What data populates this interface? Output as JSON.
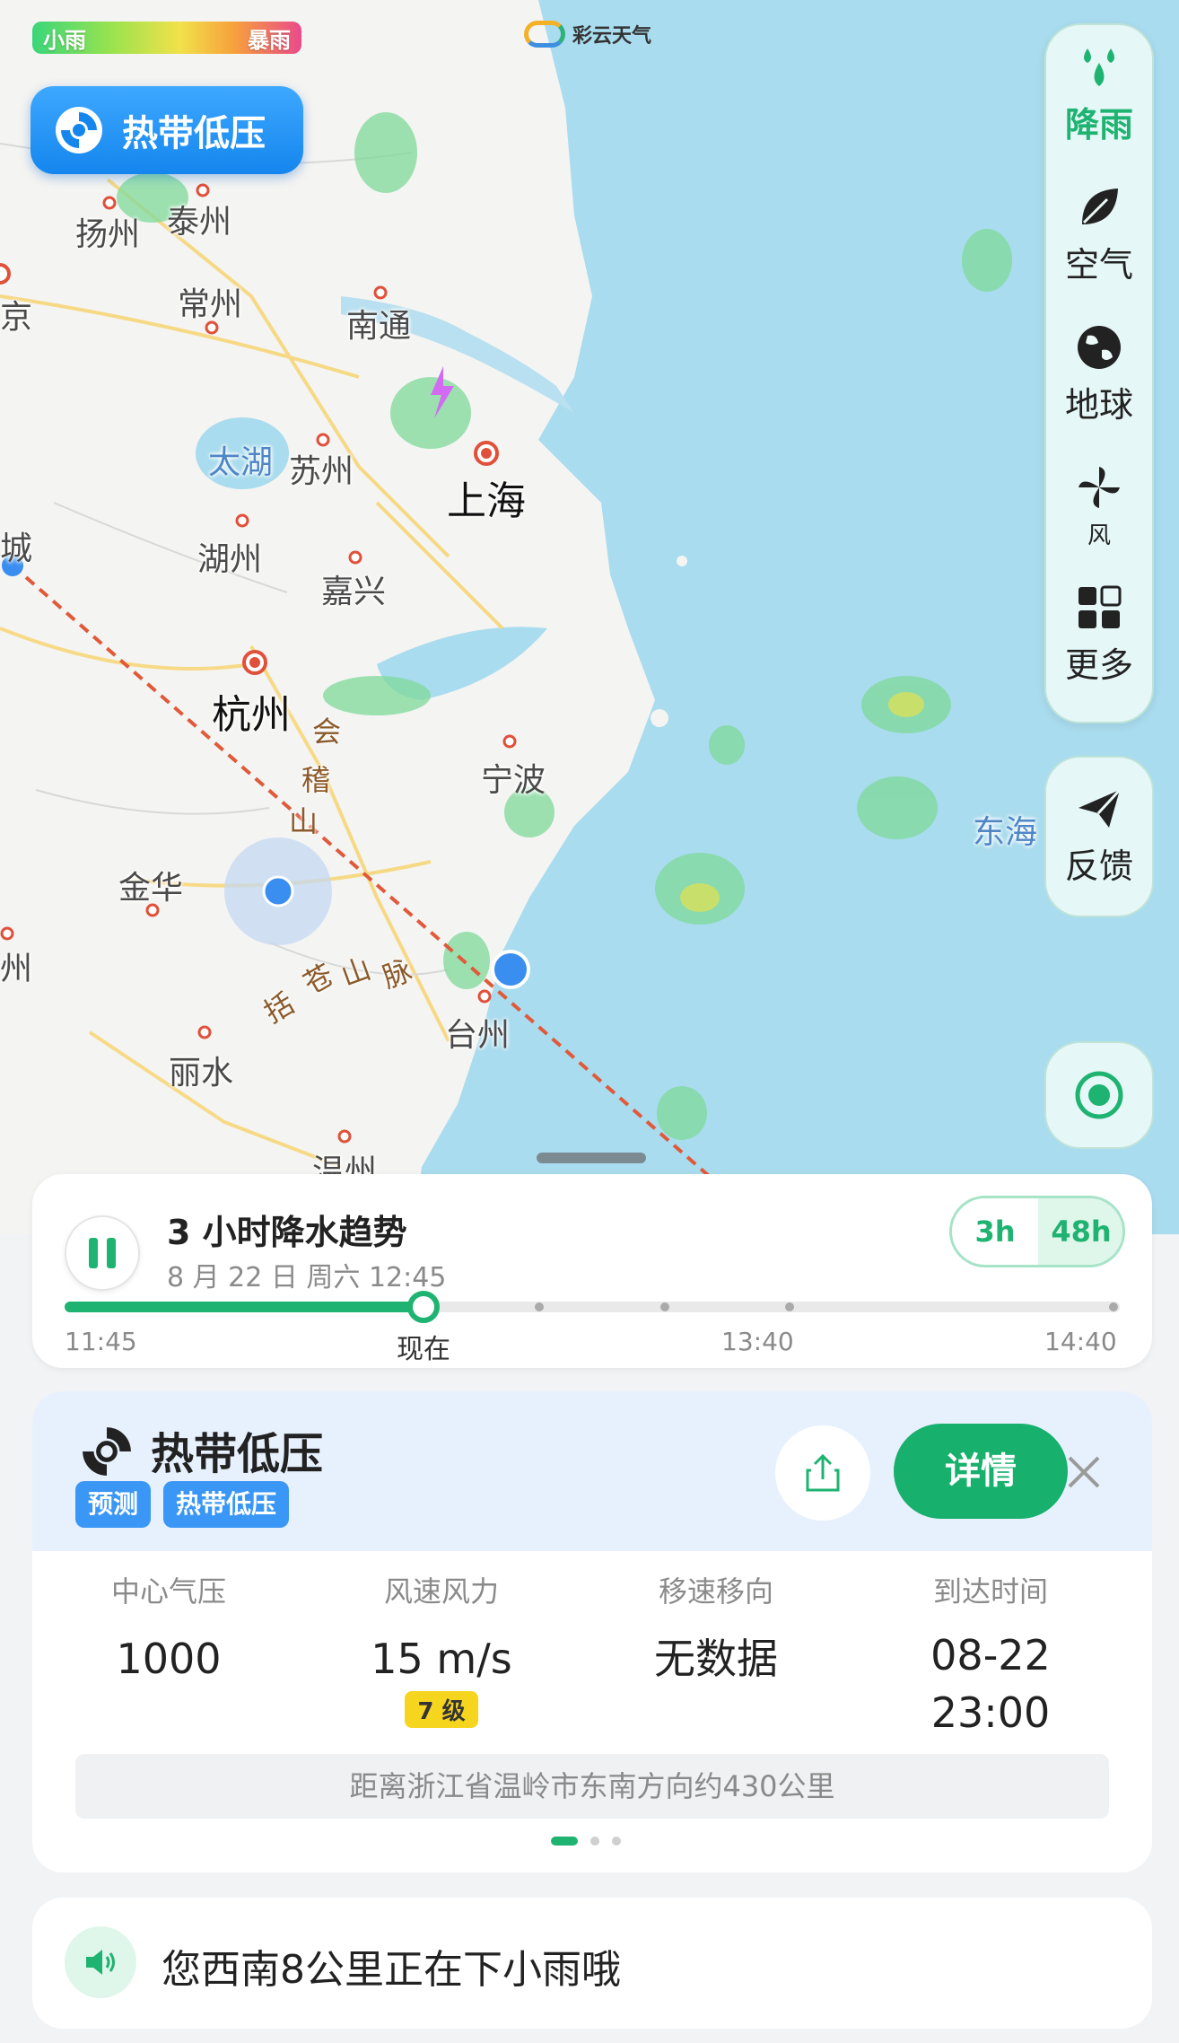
{
  "legend": {
    "low": "小雨",
    "high": "暴雨"
  },
  "brand": "彩云天气",
  "typhoon_tag": "热带低压",
  "map": {
    "cities": [
      {
        "name": "扬州"
      },
      {
        "name": "泰州"
      },
      {
        "name": "京"
      },
      {
        "name": "常州"
      },
      {
        "name": "南通"
      },
      {
        "name": "太湖"
      },
      {
        "name": "苏州"
      },
      {
        "name": "上海"
      },
      {
        "name": "城"
      },
      {
        "name": "湖州"
      },
      {
        "name": "嘉兴"
      },
      {
        "name": "杭州"
      },
      {
        "name": "宁波"
      },
      {
        "name": "金华"
      },
      {
        "name": "州"
      },
      {
        "name": "台州"
      },
      {
        "name": "丽水"
      },
      {
        "name": "温州"
      },
      {
        "name": "东海"
      }
    ],
    "mountains": [
      "会",
      "稽",
      "山",
      "括",
      "苍",
      "山",
      "脉"
    ]
  },
  "toolbar": {
    "items": [
      {
        "label": "降雨",
        "icon": "rain-drops-icon",
        "active": true
      },
      {
        "label": "空气",
        "icon": "leaf-icon",
        "active": false
      },
      {
        "label": "地球",
        "icon": "globe-icon",
        "active": false
      },
      {
        "label": "风",
        "icon": "pinwheel-icon",
        "active": false
      },
      {
        "label": "更多",
        "icon": "grid-icon",
        "active": false
      }
    ],
    "feedback": "反馈"
  },
  "rain_card": {
    "title": "3 小时降水趋势",
    "date": "8 月 22 日 周六 12:45",
    "range_options": [
      "3h",
      "48h"
    ],
    "progress": 0.34,
    "time_labels": [
      "11:45",
      "现在",
      "13:40",
      "14:40"
    ]
  },
  "typhoon_card": {
    "name": "热带低压",
    "badges": [
      "预测",
      "热带低压"
    ],
    "detail_label": "详情",
    "stats": [
      {
        "label": "中心气压",
        "value": "1000"
      },
      {
        "label": "风速风力",
        "value": "15 m/s",
        "level": "7 级"
      },
      {
        "label": "移速移向",
        "value": "无数据"
      },
      {
        "label": "到达时间",
        "value": "08-22",
        "value2": "23:00"
      }
    ],
    "distance": "距离浙江省温岭市东南方向约430公里",
    "page_count": 3,
    "page_index": 0
  },
  "alert": {
    "text": "您西南8公里正在下小雨哦"
  },
  "colors": {
    "accent": "#1fb371",
    "typhoon_blue": "#1586ee",
    "track": "#e05a3a"
  }
}
